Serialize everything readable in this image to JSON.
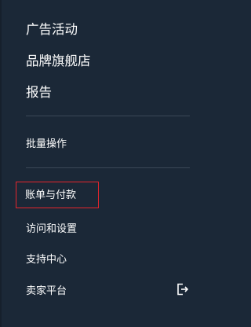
{
  "menu": {
    "items_top": [
      {
        "label": "广告活动"
      },
      {
        "label": "品牌旗舰店"
      },
      {
        "label": "报告"
      }
    ],
    "bulk_operations": {
      "label": "批量操作"
    },
    "items_bottom": [
      {
        "label": "账单与付款",
        "highlighted": true
      },
      {
        "label": "访问和设置"
      },
      {
        "label": "支持中心"
      },
      {
        "label": "卖家平台",
        "icon": "sign-out-icon"
      }
    ]
  },
  "colors": {
    "background": "#1b2837",
    "text": "#ffffff",
    "divider": "#3b4857",
    "highlight_border": "#e5252c"
  }
}
